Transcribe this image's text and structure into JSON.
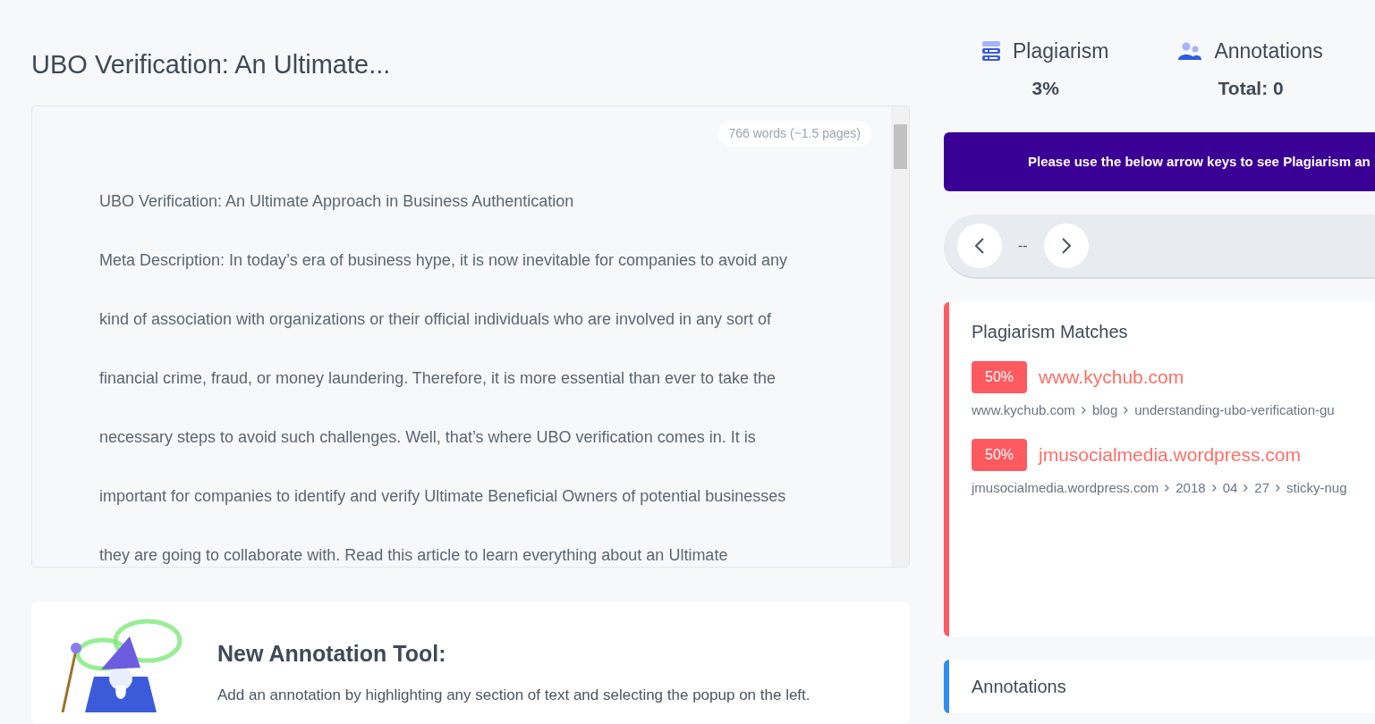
{
  "document": {
    "title": "UBO Verification: An Ultimate...",
    "word_count": "766 words (~1.5 pages)",
    "paragraphs": [
      "UBO Verification: An Ultimate Approach in Business Authentication",
      "Meta Description: In today’s era of business hype, it is now inevitable for companies to avoid any",
      "kind of association with organizations or their official individuals who are involved in any sort of",
      "financial crime, fraud, or money laundering. Therefore, it is more essential than ever to take the",
      "necessary steps to avoid such challenges. Well, that’s where UBO verification comes in. It is",
      "important for companies to identify and verify Ultimate Beneficial Owners of potential businesses",
      "they are going to collaborate with. Read this article to learn everything about an Ultimate"
    ]
  },
  "promo": {
    "title": "New Annotation Tool:",
    "text": "Add an annotation by highlighting any section of text and selecting the popup on the left."
  },
  "stats": [
    {
      "kind": "plagiarism",
      "label": "Plagiarism",
      "value": "3%"
    },
    {
      "kind": "annotations",
      "label": "Annotations",
      "value": "Total: 0"
    }
  ],
  "banner": "Please use the below arrow keys to see Plagiarism an",
  "navigator": {
    "position": "--"
  },
  "matches": {
    "title": "Plagiarism Matches",
    "items": [
      {
        "percent": "50%",
        "site": "www.kychub.com",
        "path": [
          "www.kychub.com",
          "blog",
          "understanding-ubo-verification-gu"
        ]
      },
      {
        "percent": "50%",
        "site": "jmusocialmedia.wordpress.com",
        "path": [
          "jmusocialmedia.wordpress.com",
          "2018",
          "04",
          "27",
          "sticky-nug"
        ]
      }
    ]
  },
  "annotations": {
    "title": "Annotations"
  }
}
